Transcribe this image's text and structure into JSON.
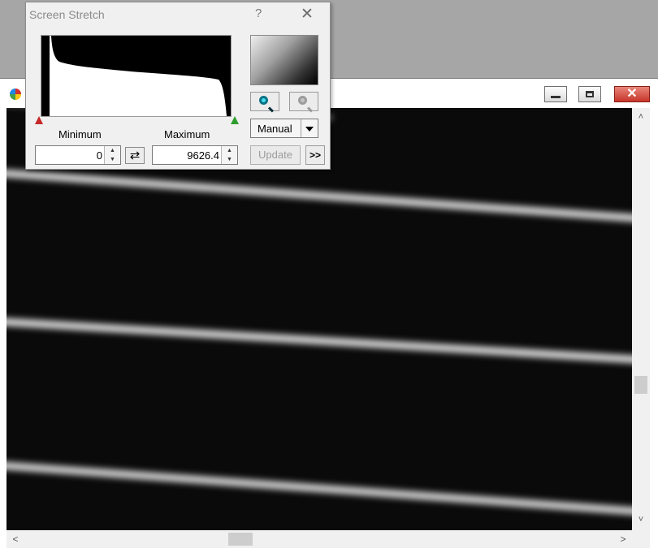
{
  "dialog": {
    "title": "Screen Stretch",
    "help_label": "?",
    "close_label": "✕",
    "minimum_label": "Minimum",
    "maximum_label": "Maximum",
    "minimum_value": "0",
    "maximum_value": "9626.4",
    "swap_label": "⇄",
    "mode_value": "Manual",
    "update_label": "Update",
    "more_label": ">>",
    "histogram_description": "white fill, high left edge dropping to a plateau, falling off at right"
  },
  "image_window": {
    "close_label": "✕",
    "scroll_left_label": "<",
    "scroll_right_label": ">",
    "scroll_up_label": "˄",
    "scroll_down_label": "˅"
  },
  "icons": {
    "app": "app-color-wheel-icon",
    "zoom_in": "zoom-in-magnifier-icon",
    "zoom_out": "zoom-out-magnifier-icon",
    "swap": "swap-arrows-icon",
    "dropdown": "chevron-down-icon"
  },
  "colors": {
    "min_marker": "#c62828",
    "max_marker": "#2e9d2e",
    "close_button": "#c7352a",
    "image_background": "#0a0a0a",
    "streak": "#dcdcdc"
  }
}
